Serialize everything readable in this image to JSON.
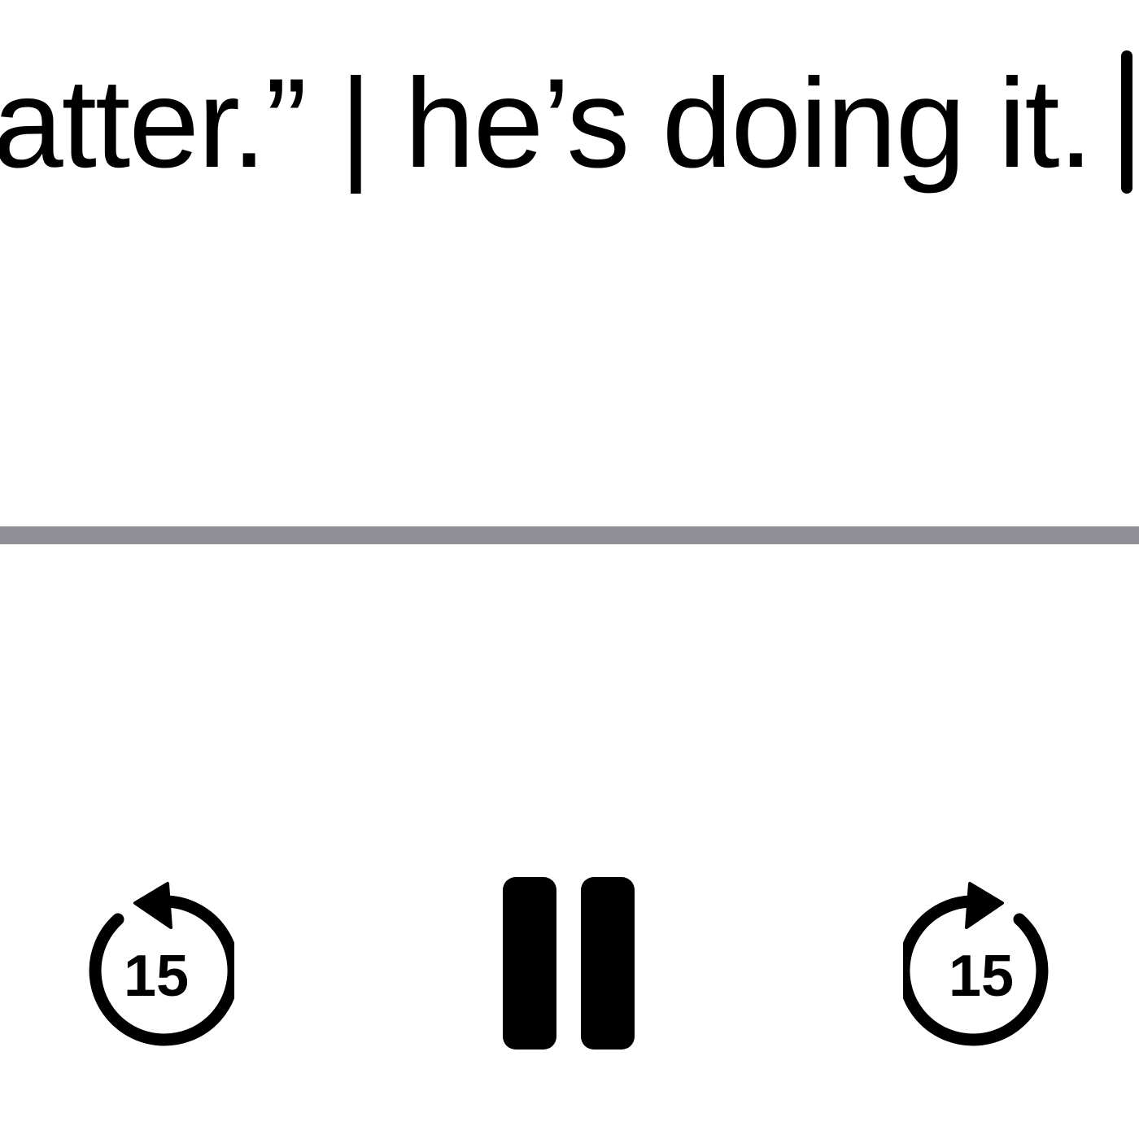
{
  "transcript": {
    "visible_text": "atter.” | he’s doing it."
  },
  "playback": {
    "skip_back": {
      "icon": "gobackward-15-icon",
      "seconds": "15"
    },
    "play_pause": {
      "icon": "pause-icon"
    },
    "skip_forward": {
      "icon": "goforward-15-icon",
      "seconds": "15"
    }
  },
  "colors": {
    "text": "#000000",
    "background": "#ffffff",
    "progress_track": "#8f8e96"
  }
}
